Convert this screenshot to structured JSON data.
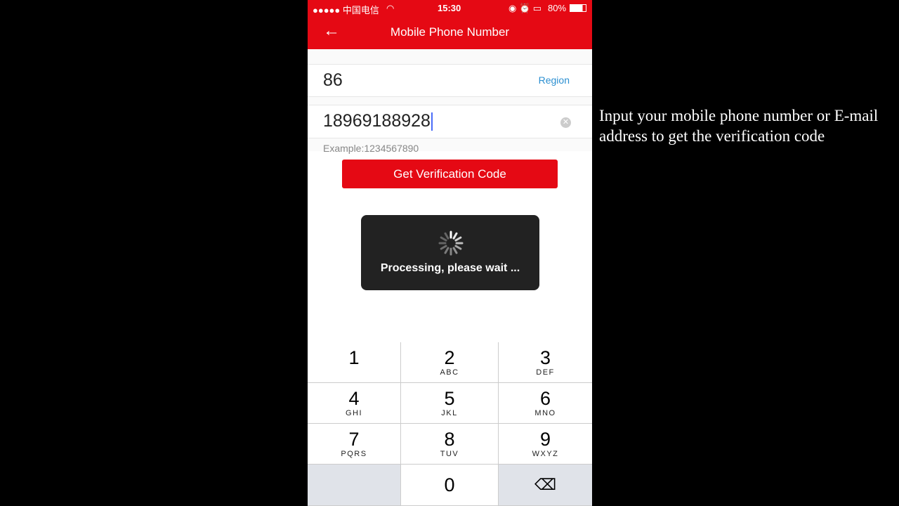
{
  "status_bar": {
    "carrier": "●●●●● 中国电信",
    "time": "15:30",
    "battery": "80%"
  },
  "header": {
    "title": "Mobile Phone Number",
    "back_icon": "arrow-left-icon"
  },
  "form": {
    "country_code": "86",
    "region_label": "Region",
    "phone_value": "18969188928",
    "example": "Example:1234567890",
    "button_label": "Get Verification Code"
  },
  "toast": {
    "message": "Processing, please wait ..."
  },
  "keypad": [
    {
      "digit": "1",
      "letters": ""
    },
    {
      "digit": "2",
      "letters": "ABC"
    },
    {
      "digit": "3",
      "letters": "DEF"
    },
    {
      "digit": "4",
      "letters": "GHI"
    },
    {
      "digit": "5",
      "letters": "JKL"
    },
    {
      "digit": "6",
      "letters": "MNO"
    },
    {
      "digit": "7",
      "letters": "PQRS"
    },
    {
      "digit": "8",
      "letters": "TUV"
    },
    {
      "digit": "9",
      "letters": "WXYZ"
    },
    {
      "digit": "",
      "letters": ""
    },
    {
      "digit": "0",
      "letters": ""
    },
    {
      "digit": "⌫",
      "letters": ""
    }
  ],
  "caption": "Input your mobile phone number or E-mail address to get the verification code",
  "colors": {
    "brand": "#e50914",
    "link": "#2b8fd1"
  }
}
